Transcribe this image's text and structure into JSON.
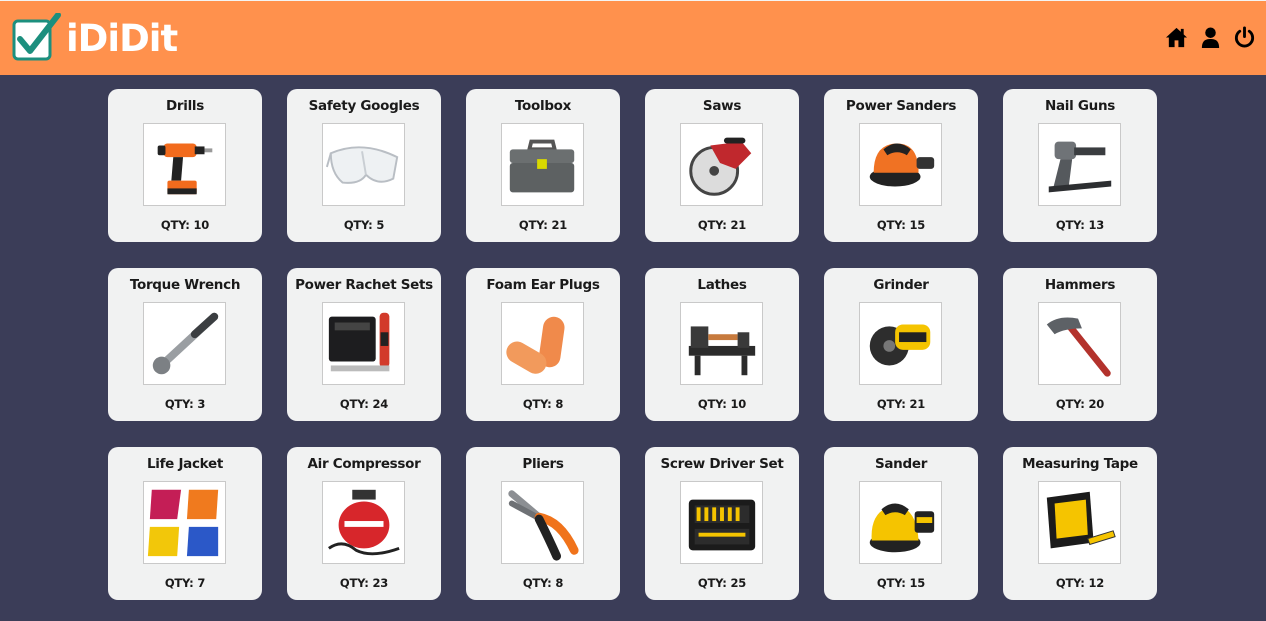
{
  "app": {
    "name": "iDiDit"
  },
  "nav": {
    "home": "home-icon",
    "profile": "user-icon",
    "logout": "power-icon"
  },
  "colors": {
    "header": "#ff914d",
    "background": "#3b3d58",
    "card": "#f1f2f2",
    "logo_check": "#1c8f7e"
  },
  "items": [
    {
      "name": "Drills",
      "qty": "QTY: 10",
      "icon": "drill"
    },
    {
      "name": "Safety Googles",
      "qty": "QTY: 5",
      "icon": "goggles"
    },
    {
      "name": "Toolbox",
      "qty": "QTY: 21",
      "icon": "toolbox"
    },
    {
      "name": "Saws",
      "qty": "QTY: 21",
      "icon": "saw"
    },
    {
      "name": "Power Sanders",
      "qty": "QTY: 15",
      "icon": "sander-orange"
    },
    {
      "name": "Nail Guns",
      "qty": "QTY: 13",
      "icon": "nailgun"
    },
    {
      "name": "Torque Wrench",
      "qty": "QTY: 3",
      "icon": "wrench"
    },
    {
      "name": "Power Rachet Sets",
      "qty": "QTY: 24",
      "icon": "rachet"
    },
    {
      "name": "Foam Ear Plugs",
      "qty": "QTY: 8",
      "icon": "earplugs"
    },
    {
      "name": "Lathes",
      "qty": "QTY: 10",
      "icon": "lathe"
    },
    {
      "name": "Grinder",
      "qty": "QTY: 21",
      "icon": "grinder"
    },
    {
      "name": "Hammers",
      "qty": "QTY: 20",
      "icon": "hammer"
    },
    {
      "name": "Life Jacket",
      "qty": "QTY: 7",
      "icon": "lifejacket"
    },
    {
      "name": "Air Compressor",
      "qty": "QTY: 23",
      "icon": "compressor"
    },
    {
      "name": "Pliers",
      "qty": "QTY: 8",
      "icon": "pliers"
    },
    {
      "name": "Screw Driver Set",
      "qty": "QTY: 25",
      "icon": "screwdriver-set"
    },
    {
      "name": "Sander",
      "qty": "QTY: 15",
      "icon": "sander-yellow"
    },
    {
      "name": "Measuring Tape",
      "qty": "QTY: 12",
      "icon": "tape"
    }
  ]
}
